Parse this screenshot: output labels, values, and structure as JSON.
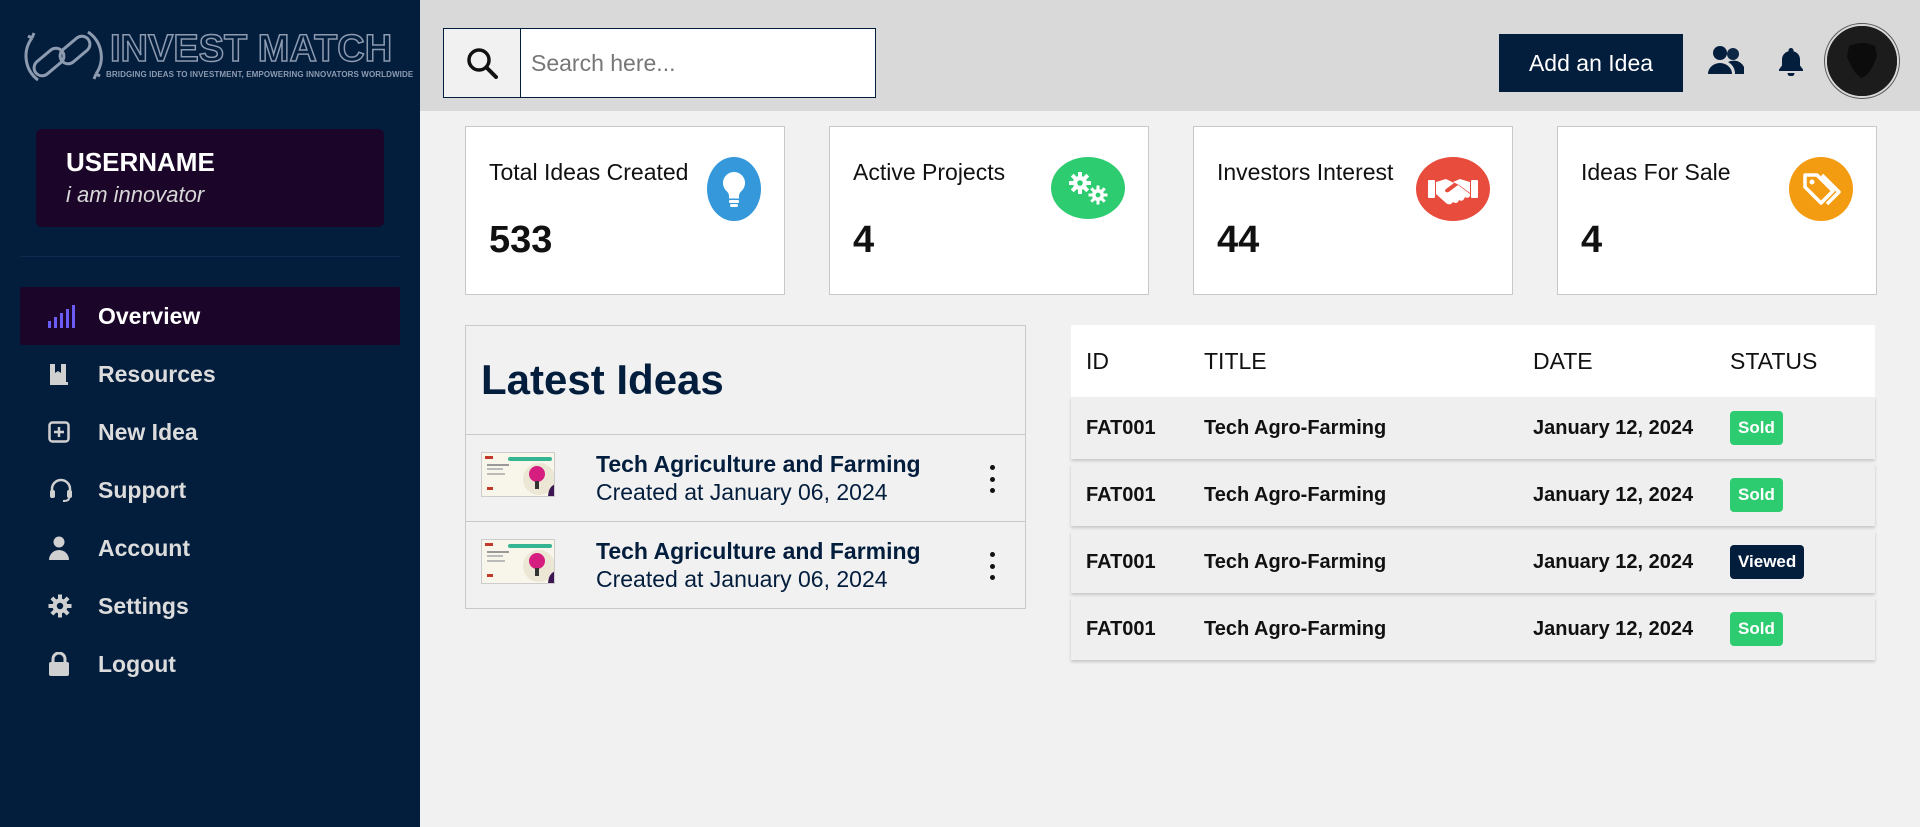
{
  "brand": {
    "name": "INVEST MATCH",
    "tagline": "BRIDGING IDEAS TO INVESTMENT, EMPOWERING INNOVATORS WORLDWIDE"
  },
  "user": {
    "name": "USERNAME",
    "role": "i am innovator"
  },
  "sidebar": {
    "items": [
      {
        "label": "Overview",
        "icon": "signal-bars-icon",
        "active": true
      },
      {
        "label": "Resources",
        "icon": "bookmark-book-icon",
        "active": false
      },
      {
        "label": "New Idea",
        "icon": "plus-square-icon",
        "active": false
      },
      {
        "label": "Support",
        "icon": "headset-icon",
        "active": false
      },
      {
        "label": "Account",
        "icon": "user-icon",
        "active": false
      },
      {
        "label": "Settings",
        "icon": "gear-icon",
        "active": false
      },
      {
        "label": "Logout",
        "icon": "lock-icon",
        "active": false
      }
    ]
  },
  "topbar": {
    "search_placeholder": "Search here...",
    "search_value": "",
    "add_button": "Add an Idea"
  },
  "stats": [
    {
      "label": "Total Ideas Created",
      "value": "533",
      "icon": "lightbulb-icon",
      "color": "#3498db"
    },
    {
      "label": "Active Projects",
      "value": "4",
      "icon": "gears-icon",
      "color": "#2ecc71"
    },
    {
      "label": "Investors Interest",
      "value": "44",
      "icon": "handshake-icon",
      "color": "#e74c3c"
    },
    {
      "label": "Ideas For Sale",
      "value": "4",
      "icon": "price-tags-icon",
      "color": "#f39c12"
    }
  ],
  "latest_ideas": {
    "title": "Latest Ideas",
    "items": [
      {
        "name": "Tech Agriculture and Farming",
        "date": "Created at January 06, 2024"
      },
      {
        "name": "Tech Agriculture and Farming",
        "date": "Created at January 06, 2024"
      }
    ]
  },
  "table": {
    "headers": [
      "ID",
      "TITLE",
      "DATE",
      "STATUS"
    ],
    "rows": [
      {
        "id": "FAT001",
        "title": "Tech Agro-Farming",
        "date": "January 12, 2024",
        "status": "Sold"
      },
      {
        "id": "FAT001",
        "title": "Tech Agro-Farming",
        "date": "January 12, 2024",
        "status": "Sold"
      },
      {
        "id": "FAT001",
        "title": "Tech Agro-Farming",
        "date": "January 12, 2024",
        "status": "Viewed"
      },
      {
        "id": "FAT001",
        "title": "Tech Agro-Farming",
        "date": "January 12, 2024",
        "status": "Sold"
      }
    ]
  },
  "colors": {
    "sidebar_bg": "#031d3d",
    "active_bg": "#1b0629",
    "sold": "#2ecc71",
    "viewed": "#031d3d"
  }
}
